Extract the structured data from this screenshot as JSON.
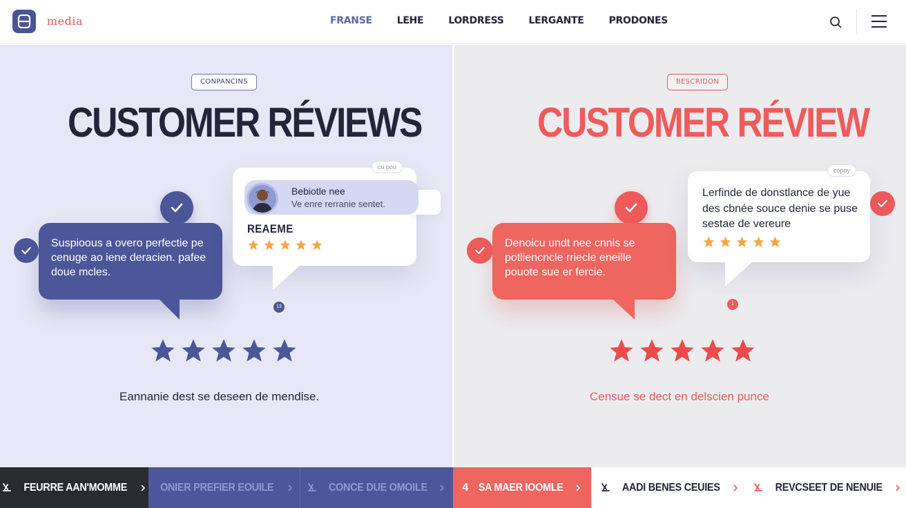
{
  "header": {
    "logo_text": "media",
    "nav": [
      "FRANSE",
      "LEHE",
      "LORDRESS",
      "LERGANTE",
      "PRODONES"
    ],
    "active_nav": "FRANSE",
    "icons": [
      "grid-logo-icon",
      "search-icon",
      "hamburger-menu-icon"
    ]
  },
  "left_panel": {
    "tag": "CONPANCINS",
    "title": "CUSTOMER RÉVIEWS",
    "bubble_text": "Suspioous a overo perfectie pe cenuge ao iene deracien. pafee doue mcles.",
    "card": {
      "badge": "cu pou",
      "reviewer_name": "Bebiotle nee",
      "reviewer_subtitle": "Ve enre rerranie sentet.",
      "heading": "REAEME",
      "rating": 5
    },
    "dot_label": "13",
    "big_rating": 5,
    "caption": "Eannanie dest se deseen de mendise.",
    "accent_color": "#4c5799"
  },
  "right_panel": {
    "tag": "BESCRIDON",
    "title": "CUSTOMER RÉVIEW",
    "bubble_text": "Denoicu undt nee cnnis se potliencncle rriecle eneille pouote sue er fercie.",
    "card": {
      "badge": "copoy",
      "text": "Lerfinde de donstlance de yue des cbnée souce denie se puse sestae de vereure",
      "rating": 5
    },
    "dot_label": "1",
    "big_rating": 5,
    "caption": "Censue se dect en delscien punce",
    "accent_color": "#ef6560"
  },
  "bottom_bar": [
    {
      "label": "FEURRE AAN'MOMME",
      "icon": "cross-arrow-icon"
    },
    {
      "label": "ONIER PREFIER EOUILE",
      "icon": "chevron-right-icon"
    },
    {
      "label": "CONCE DUE OMOILE",
      "icon": "cross-arrow-icon"
    },
    {
      "label": "SA MAER IOOMLE",
      "prefix": "4",
      "icon": "chevron-right-icon"
    },
    {
      "label": "AADI BENES CEUIES",
      "icon": "cross-arrow-icon"
    },
    {
      "label": "REVCSEET DE NENUIE",
      "icon": "cross-arrow-icon"
    }
  ]
}
